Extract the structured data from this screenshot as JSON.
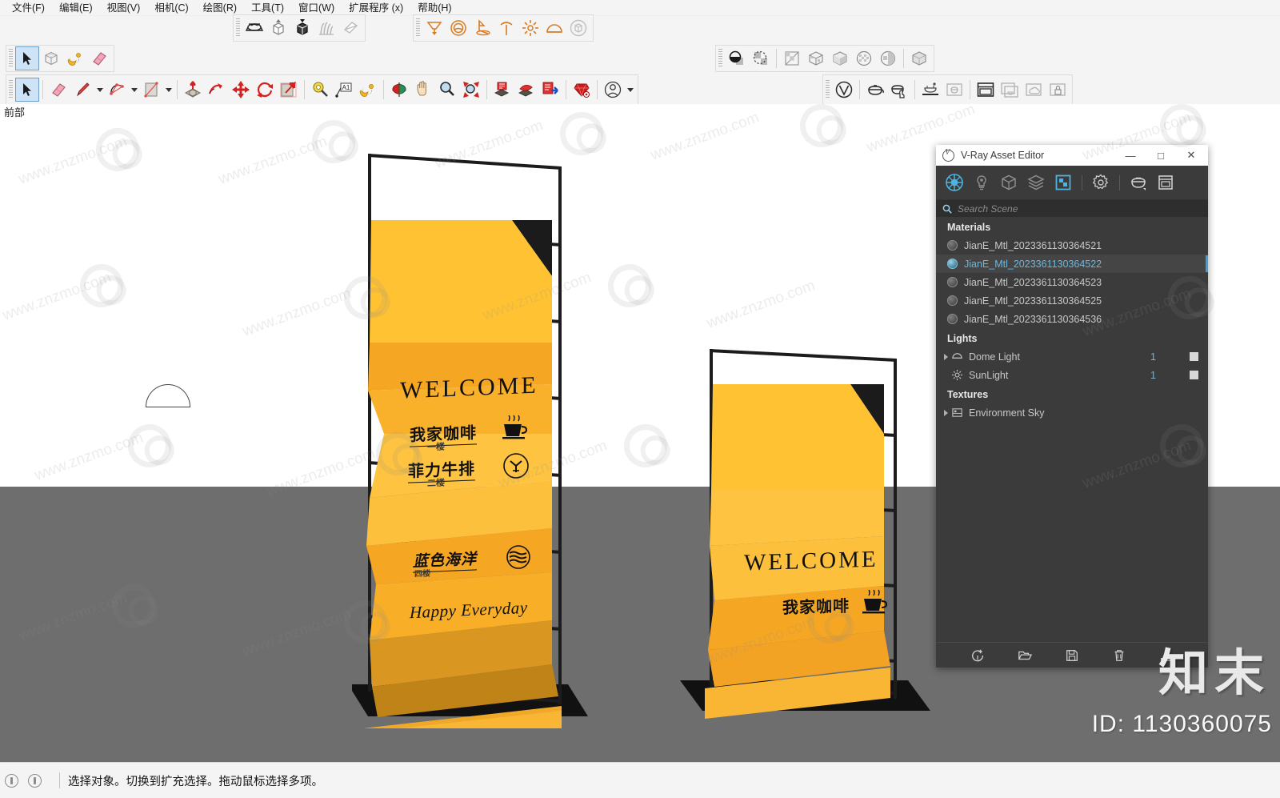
{
  "menubar": {
    "items": [
      {
        "label": "文件(F)",
        "name": "menu-file"
      },
      {
        "label": "编辑(E)",
        "name": "menu-edit"
      },
      {
        "label": "视图(V)",
        "name": "menu-view"
      },
      {
        "label": "相机(C)",
        "name": "menu-camera"
      },
      {
        "label": "绘图(R)",
        "name": "menu-draw"
      },
      {
        "label": "工具(T)",
        "name": "menu-tools"
      },
      {
        "label": "窗口(W)",
        "name": "menu-window"
      },
      {
        "label": "扩展程序 (x)",
        "name": "menu-extensions"
      },
      {
        "label": "帮助(H)",
        "name": "menu-help"
      }
    ]
  },
  "viewport": {
    "label": "前部",
    "background_color": "#ffffff",
    "ground_color": "#6e6e6e"
  },
  "models": {
    "left_stand": {
      "headline": "WELCOME",
      "entries": [
        {
          "title": "我家咖啡",
          "subtitle": "一楼",
          "icon": "coffee-cup-icon"
        },
        {
          "title": "菲力牛排",
          "subtitle": "二楼",
          "icon": "steak-icon"
        },
        {
          "title": "蓝色海洋",
          "subtitle": "四楼",
          "icon": "wave-icon"
        }
      ],
      "footer": "Happy Everyday"
    },
    "right_stand": {
      "headline": "WELCOME",
      "entries": [
        {
          "title": "我家咖啡",
          "subtitle": "",
          "icon": "coffee-cup-icon"
        }
      ]
    },
    "colors": {
      "panel_light": "#ffc233",
      "panel_mid": "#f5a623",
      "panel_dark": "#d99722",
      "panel_deep": "#c08318",
      "frame": "#1c1c1c",
      "base": "#141414"
    }
  },
  "vray": {
    "window": {
      "title": "V-Ray Asset Editor",
      "minimize": "—",
      "maximize": "□",
      "close": "✕"
    },
    "tabs": [
      {
        "name": "tab-materials",
        "icon": "material-sphere-icon",
        "active": true
      },
      {
        "name": "tab-lights",
        "icon": "light-bulb-icon",
        "active": false
      },
      {
        "name": "tab-geometry",
        "icon": "cube-icon",
        "active": false
      },
      {
        "name": "tab-render-elements",
        "icon": "layers-icon",
        "active": false
      },
      {
        "name": "tab-textures",
        "icon": "checker-square-icon",
        "active": true
      },
      {
        "name": "tab-settings",
        "icon": "gear-icon",
        "active": false
      },
      {
        "name": "tab-render",
        "icon": "teapot-icon",
        "active": false
      },
      {
        "name": "tab-frame-buffer",
        "icon": "window-icon",
        "active": false
      }
    ],
    "search": {
      "placeholder": "Search Scene",
      "value": "",
      "icon": "search-icon"
    },
    "sections": {
      "materials": {
        "title": "Materials",
        "items": [
          {
            "label": "JianE_Mtl_2023361130364521",
            "selected": false
          },
          {
            "label": "JianE_Mtl_2023361130364522",
            "selected": true
          },
          {
            "label": "JianE_Mtl_2023361130364523",
            "selected": false
          },
          {
            "label": "JianE_Mtl_2023361130364525",
            "selected": false
          },
          {
            "label": "JianE_Mtl_2023361130364536",
            "selected": false
          }
        ]
      },
      "lights": {
        "title": "Lights",
        "items": [
          {
            "label": "Dome Light",
            "count": "1",
            "icon": "dome-light-icon",
            "expandable": true,
            "enabled": true
          },
          {
            "label": "SunLight",
            "count": "1",
            "icon": "sun-light-icon",
            "expandable": false,
            "enabled": true
          }
        ]
      },
      "textures": {
        "title": "Textures",
        "items": [
          {
            "label": "Environment Sky",
            "icon": "texture-icon",
            "expandable": true
          }
        ]
      }
    },
    "footer_buttons": [
      {
        "name": "add-asset-button",
        "icon": "add-circle-icon"
      },
      {
        "name": "open-asset-button",
        "icon": "folder-open-icon"
      },
      {
        "name": "save-asset-button",
        "icon": "floppy-save-icon"
      },
      {
        "name": "delete-asset-button",
        "icon": "trash-icon"
      },
      {
        "name": "import-export-button",
        "icon": "tray-icon"
      }
    ],
    "collapse_left": "‹",
    "collapse_right": "›"
  },
  "toolbars": {
    "vray_objects": [
      {
        "name": "vray-infinite-plane-tool",
        "icon": "infinite-plane-icon"
      },
      {
        "name": "vray-proxy-import-tool",
        "icon": "proxy-cube-up-icon"
      },
      {
        "name": "vray-proxy-export-tool",
        "icon": "proxy-cube-down-icon"
      },
      {
        "name": "vray-fur-tool",
        "icon": "fur-icon"
      },
      {
        "name": "vray-clipper-tool",
        "icon": "clipper-icon"
      }
    ],
    "vray_lights": [
      {
        "name": "vray-rectangle-light-tool",
        "icon": "rect-light-icon"
      },
      {
        "name": "vray-sphere-light-tool",
        "icon": "sphere-light-icon"
      },
      {
        "name": "vray-spot-light-tool",
        "icon": "spot-light-icon"
      },
      {
        "name": "vray-ies-light-tool",
        "icon": "ies-light-icon"
      },
      {
        "name": "vray-omni-light-tool",
        "icon": "omni-light-icon"
      },
      {
        "name": "vray-dome-light-tool",
        "icon": "dome-light-icon"
      },
      {
        "name": "vray-mesh-light-tool",
        "icon": "mesh-light-icon"
      }
    ],
    "principal_small": [
      {
        "name": "select-tool",
        "icon": "arrow-cursor-icon",
        "active": true
      },
      {
        "name": "make-component-tool",
        "icon": "component-icon"
      },
      {
        "name": "paint-bucket-tool",
        "icon": "paint-bucket-icon"
      },
      {
        "name": "eraser-tool",
        "icon": "eraser-icon"
      }
    ],
    "main": [
      {
        "name": "select-tool",
        "icon": "arrow-cursor-icon",
        "active": true
      },
      {
        "name": "eraser-tool",
        "icon": "eraser-icon"
      },
      {
        "name": "line-tool",
        "icon": "pencil-icon",
        "dropdown": true
      },
      {
        "name": "arc-tool",
        "icon": "arc-icon",
        "dropdown": true
      },
      {
        "name": "rectangle-tool",
        "icon": "rectangle-icon",
        "dropdown": true
      },
      {
        "name": "push-pull-tool",
        "icon": "push-pull-icon"
      },
      {
        "name": "follow-me-tool",
        "icon": "follow-me-icon"
      },
      {
        "name": "move-tool",
        "icon": "move-arrows-icon"
      },
      {
        "name": "rotate-tool",
        "icon": "rotate-icon"
      },
      {
        "name": "scale-tool",
        "icon": "scale-icon"
      },
      {
        "name": "tape-measure-tool",
        "icon": "tape-measure-icon"
      },
      {
        "name": "text-tool",
        "icon": "text-a1-icon"
      },
      {
        "name": "paint-bucket-tool",
        "icon": "paint-bucket-icon"
      },
      {
        "name": "section-plane-tool",
        "icon": "section-plane-icon"
      },
      {
        "name": "pan-tool",
        "icon": "hand-pan-icon"
      },
      {
        "name": "zoom-tool",
        "icon": "magnifier-icon"
      },
      {
        "name": "zoom-extents-tool",
        "icon": "zoom-extents-icon"
      },
      {
        "name": "add-location-tool",
        "icon": "geo-location-icon"
      },
      {
        "name": "photo-texture-tool",
        "icon": "photo-texture-icon"
      },
      {
        "name": "model-info-tool",
        "icon": "model-info-icon"
      },
      {
        "name": "extension-warehouse-tool",
        "icon": "ruby-icon"
      },
      {
        "name": "account-tool",
        "icon": "user-avatar-icon",
        "dropdown": true
      }
    ],
    "styles": [
      {
        "name": "shadows-toggle",
        "icon": "shadow-sphere-icon"
      },
      {
        "name": "fog-toggle",
        "icon": "fog-icon"
      },
      {
        "name": "style-wireframe",
        "icon": "wireframe-style-icon"
      },
      {
        "name": "style-hidden-line",
        "icon": "hidden-line-style-icon"
      },
      {
        "name": "style-shaded",
        "icon": "shaded-style-icon"
      },
      {
        "name": "style-texture",
        "icon": "texture-style-icon"
      },
      {
        "name": "style-monochrome",
        "icon": "monochrome-style-icon"
      },
      {
        "name": "style-xray",
        "icon": "xray-style-icon"
      }
    ],
    "vray_render": [
      {
        "name": "vray-asset-editor-button",
        "icon": "vray-logo-icon"
      },
      {
        "name": "vray-render-button",
        "icon": "teapot-icon"
      },
      {
        "name": "vray-interactive-render-button",
        "icon": "teapot-hand-icon"
      },
      {
        "name": "vray-render-cloud-button",
        "icon": "render-cloud-icon"
      },
      {
        "name": "vray-batch-render-button",
        "icon": "batch-render-icon"
      },
      {
        "name": "vray-frame-buffer-button",
        "icon": "frame-buffer-icon"
      },
      {
        "name": "vray-lens-effects-button",
        "icon": "lens-effects-icon"
      },
      {
        "name": "vray-cloud-button",
        "icon": "cloud-icon"
      },
      {
        "name": "vray-lock-button",
        "icon": "lock-icon"
      }
    ]
  },
  "statusbar": {
    "message": "选择对象。切换到扩充选择。拖动鼠标选择多项。",
    "icons": [
      "info-icon",
      "help-icon"
    ]
  },
  "watermark": {
    "site": "www.znzmo.com",
    "brand": "知末",
    "id": "ID: 1130360075"
  }
}
